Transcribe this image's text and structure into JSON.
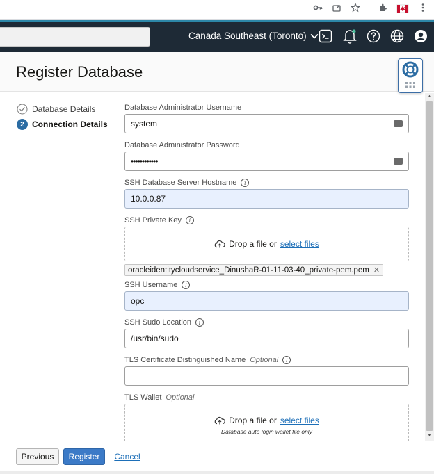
{
  "browser": {
    "icons": [
      "key-icon",
      "share-icon",
      "star-icon",
      "extensions-icon",
      "profile-flag-icon",
      "more-icon"
    ]
  },
  "header": {
    "region": "Canada Southeast (Toronto)",
    "icons": [
      "cloud-shell-icon",
      "notifications-icon",
      "help-icon",
      "language-icon",
      "user-icon"
    ],
    "dark_color": "#1e2a36"
  },
  "page": {
    "title": "Register Database"
  },
  "steps": [
    {
      "number": "",
      "label": "Database Details",
      "status": "completed"
    },
    {
      "number": "2",
      "label": "Connection Details",
      "status": "active"
    }
  ],
  "form": {
    "admin_username": {
      "label": "Database Administrator Username",
      "value": "system"
    },
    "admin_password": {
      "label": "Database Administrator Password",
      "value": "••••••••••••"
    },
    "ssh_hostname": {
      "label": "SSH Database Server Hostname",
      "value": "10.0.0.87"
    },
    "ssh_private_key": {
      "label": "SSH Private Key",
      "drop_text": "Drop a file or",
      "select_link": "select files",
      "attached_file": "oracleidentitycloudservice_DinushaR-01-11-03-40_private-pem.pem"
    },
    "ssh_username": {
      "label": "SSH Username",
      "value": "opc"
    },
    "ssh_sudo_location": {
      "label": "SSH Sudo Location",
      "value": "/usr/bin/sudo"
    },
    "tls_cert_dn": {
      "label": "TLS Certificate Distinguished Name",
      "optional": "Optional",
      "value": ""
    },
    "tls_wallet": {
      "label": "TLS Wallet",
      "optional": "Optional",
      "drop_text": "Drop a file or",
      "select_link": "select files",
      "hint": "Database auto login wallet file only"
    }
  },
  "footer": {
    "previous": "Previous",
    "register": "Register",
    "cancel": "Cancel"
  },
  "colors": {
    "primary_button": "#3b7ac7",
    "link": "#1d6fb8",
    "autofill_bg": "#e8f0fe"
  }
}
